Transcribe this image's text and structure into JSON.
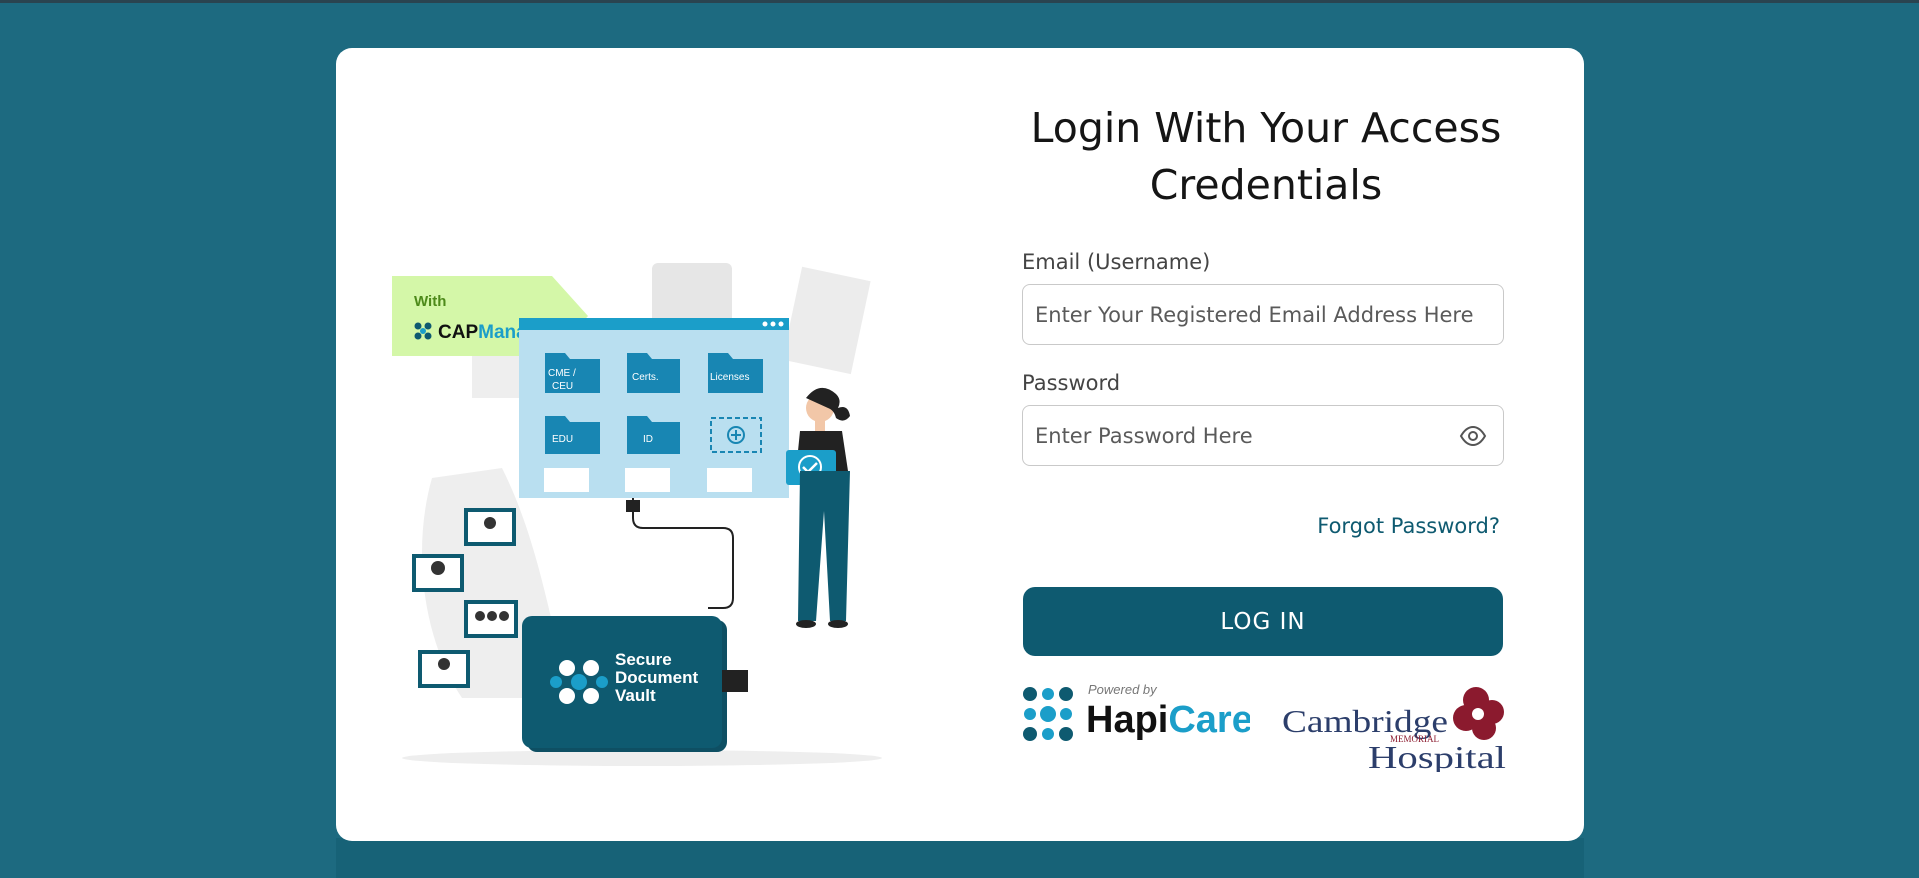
{
  "login": {
    "title_line1": "Login With Your Access",
    "title_line2": "Credentials",
    "email_label": "Email (Username)",
    "email_placeholder": "Enter Your Registered Email Address Here",
    "password_label": "Password",
    "password_placeholder": "Enter Password Here",
    "forgot_link": "Forgot Password?",
    "login_button": "LOG IN",
    "show_password_icon": "eye-icon"
  },
  "illustration": {
    "badge_with": "With",
    "badge_cap": "CAP",
    "badge_manager": "Manager",
    "folders": [
      "CME /",
      "CEU",
      "Certs.",
      "Licenses",
      "EDU",
      "ID"
    ],
    "vault_line1": "Secure",
    "vault_line2": "Document",
    "vault_line3": "Vault"
  },
  "footer_logos": {
    "powered_by": "Powered by",
    "hapi": "Hapi",
    "care": "Care",
    "cambridge_line1": "Cambridge",
    "cambridge_memorial": "MEMORIAL",
    "cambridge_line2": "Hospital"
  },
  "colors": {
    "background": "#1d6a80",
    "primary": "#0e5a70",
    "badge_green": "#d4f7a8",
    "accent_blue": "#1b9ec9"
  }
}
